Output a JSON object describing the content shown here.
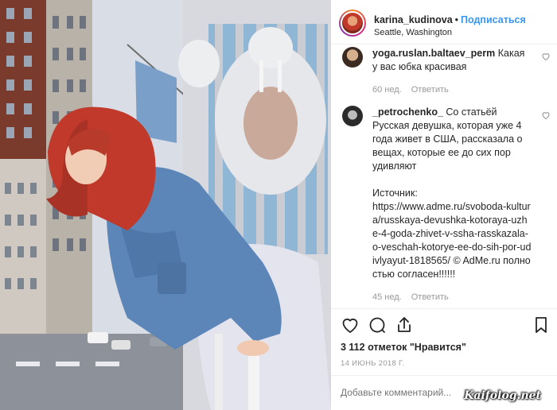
{
  "post": {
    "username": "karina_kudinova",
    "separator": "•",
    "follow_label": "Подписаться",
    "location": "Seattle, Washington"
  },
  "comments": [
    {
      "user": "yoga.ruslan.baltaev_perm",
      "text": "Какая у вас юбка красивая",
      "time": "60 нед.",
      "reply_label": "Ответить"
    },
    {
      "user": "_petrochenko_",
      "text": "Со статьёй Русская девушка, которая уже 4 года живет в США, рассказала о вещах, которые ее до сих пор удивляют",
      "source_label": "Источник:",
      "source_text": "https://www.adme.ru/svoboda-kultura/russkaya-devushka-kotoraya-uzhe-4-goda-zhivet-v-ssha-rasskazala-o-veschah-kotorye-ee-do-sih-por-udivlyayut-1818565/ © AdMe.ru полностью согласен!!!!!!",
      "time": "45 нед.",
      "reply_label": "Ответить"
    }
  ],
  "likes_text": "3 112 отметок \"Нравится\"",
  "date_text": "14 ИЮНЬ 2018 Г.",
  "add_comment_placeholder": "Добавьте комментарий...",
  "watermark": "Kaifolog.net",
  "colors": {
    "link_blue": "#3897f0",
    "muted": "#999999",
    "hair": "#c0392b"
  },
  "icons": [
    "heart-icon",
    "comment-icon",
    "share-icon",
    "bookmark-icon"
  ]
}
